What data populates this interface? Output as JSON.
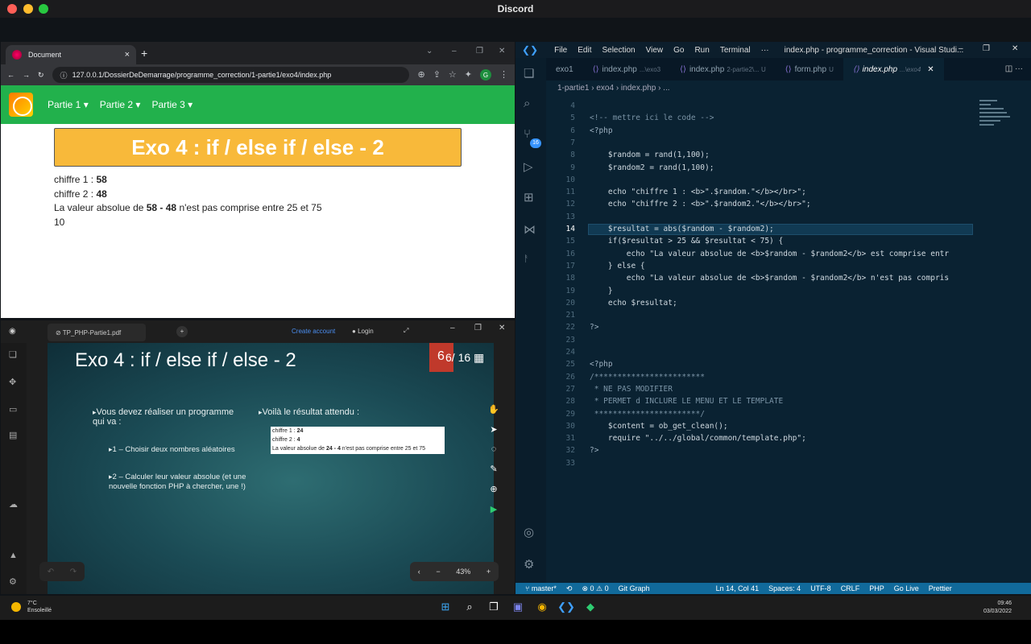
{
  "window": {
    "title": "Discord",
    "colors": {
      "close": "#ff5f57",
      "minimize": "#febc2e",
      "maximize": "#28c840"
    }
  },
  "browser": {
    "tab_title": "Document",
    "url": "127.0.0.1/DossierDeDemarrage/programme_correction/1-partie1/exo4/index.php",
    "profile_initial": "G",
    "nav": [
      "Partie 1",
      "Partie 2",
      "Partie 3"
    ],
    "page": {
      "title": "Exo 4 : if / else if / else - 2",
      "line1_label": "chiffre 1 : ",
      "line1_value": "58",
      "line2_label": "chiffre 2 : ",
      "line2_value": "48",
      "line3_pre": "La valeur absolue de ",
      "line3_bold": "58 - 48",
      "line3_post": " n'est pas comprise entre 25 et 75",
      "line4": "10"
    }
  },
  "pdf": {
    "tab_title": "TP_PHP-Partie1.pdf",
    "create_account": "Create account",
    "login": "Login",
    "slide_title": "Exo 4 : if / else if / else - 2",
    "slide_number": "6",
    "page_indicator": "6/ 16",
    "bullet1": "Vous devez réaliser un programme qui va :",
    "bullet2": "Voilà le résultat attendu :",
    "sub1": "1 – Choisir deux nombres aléatoires",
    "sub2": "2 – Calculer leur valeur absolue (et une nouvelle fonction PHP à chercher, une !)",
    "result_line1_label": "chiffre 1 : ",
    "result_line1_value": "24",
    "result_line2_label": "chiffre 2 : ",
    "result_line2_value": "4",
    "result_line3_pre": "La valeur absolue de ",
    "result_line3_bold": "24 - 4",
    "result_line3_post": " n'est pas comprise entre 25 et 75",
    "zoom": "43%"
  },
  "vscode": {
    "menu": [
      "File",
      "Edit",
      "Selection",
      "View",
      "Go",
      "Run",
      "Terminal",
      "···"
    ],
    "title": "index.php - programme_correction - Visual Studi...",
    "tabs": [
      {
        "name": "exo1",
        "dim": ""
      },
      {
        "name": "index.php",
        "dim": "...\\exo3"
      },
      {
        "name": "index.php",
        "dim": "2-partie2\\...  U"
      },
      {
        "name": "form.php",
        "dim": "U"
      },
      {
        "name": "index.php",
        "dim": "...\\exo4"
      }
    ],
    "breadcrumb": "1-partie1  ›  exo4  ›  index.php  ›  ...",
    "scm_badge": "16",
    "lines": [
      {
        "n": "4",
        "t": ""
      },
      {
        "n": "5",
        "t": "<!-- mettre ici le code -->"
      },
      {
        "n": "6",
        "t": "<?php"
      },
      {
        "n": "7",
        "t": ""
      },
      {
        "n": "8",
        "t": "    $random = rand(1,100);"
      },
      {
        "n": "9",
        "t": "    $random2 = rand(1,100);"
      },
      {
        "n": "10",
        "t": ""
      },
      {
        "n": "11",
        "t": "    echo \"chiffre 1 : <b>\".$random.\"</b></br>\";"
      },
      {
        "n": "12",
        "t": "    echo \"chiffre 2 : <b>\".$random2.\"</b></br>\";"
      },
      {
        "n": "13",
        "t": ""
      },
      {
        "n": "14",
        "t": "    $resultat = abs($random - $random2);"
      },
      {
        "n": "15",
        "t": "    if($resultat > 25 && $resultat < 75) {"
      },
      {
        "n": "16",
        "t": "        echo \"La valeur absolue de <b>$random - $random2</b> est comprise entr"
      },
      {
        "n": "17",
        "t": "    } else {"
      },
      {
        "n": "18",
        "t": "        echo \"La valeur absolue de <b>$random - $random2</b> n'est pas compris"
      },
      {
        "n": "19",
        "t": "    }"
      },
      {
        "n": "20",
        "t": "    echo $resultat;"
      },
      {
        "n": "21",
        "t": ""
      },
      {
        "n": "22",
        "t": "?>"
      },
      {
        "n": "23",
        "t": ""
      },
      {
        "n": "24",
        "t": ""
      },
      {
        "n": "25",
        "t": "<?php"
      },
      {
        "n": "26",
        "t": "/************************"
      },
      {
        "n": "27",
        "t": " * NE PAS MODIFIER"
      },
      {
        "n": "28",
        "t": " * PERMET d INCLURE LE MENU ET LE TEMPLATE"
      },
      {
        "n": "29",
        "t": " ***********************/"
      },
      {
        "n": "30",
        "t": "    $content = ob_get_clean();"
      },
      {
        "n": "31",
        "t": "    require \"../../global/common/template.php\";"
      },
      {
        "n": "32",
        "t": "?>"
      },
      {
        "n": "33",
        "t": ""
      }
    ],
    "current_line": "14",
    "status": {
      "branch": "master*",
      "problems": "⊗ 0 ⚠ 0",
      "git_graph": "Git Graph",
      "position": "Ln 14, Col 41",
      "spaces": "Spaces: 4",
      "encoding": "UTF-8",
      "eol": "CRLF",
      "lang": "PHP",
      "golive": "Go Live",
      "prettier": "Prettier"
    }
  },
  "taskbar": {
    "temp": "7°C",
    "weather": "Ensoleillé",
    "time": "09:46",
    "date": "03/03/2022"
  }
}
